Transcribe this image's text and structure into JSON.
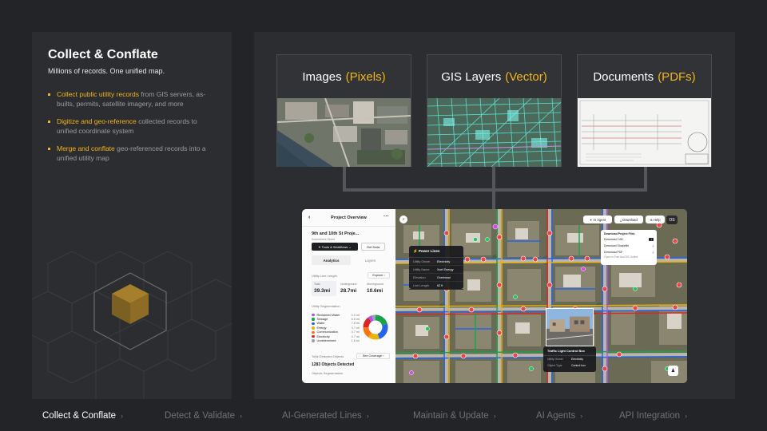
{
  "left": {
    "title": "Collect & Conflate",
    "subtitle": "Millions of records. One unified map.",
    "bullets": [
      {
        "highlight": "Collect public utility records",
        "rest": " from GIS servers, as-builts, permits, satellite imagery, and more"
      },
      {
        "highlight": "Digitize and geo-reference",
        "rest": " collected records to unified coordinate system"
      },
      {
        "highlight": "Merge and conflate",
        "rest": " geo-referenced records into a unified utility map"
      }
    ]
  },
  "cards": [
    {
      "title": "Images",
      "accent": "(Pixels)"
    },
    {
      "title": "GIS Layers",
      "accent": "(Vector)"
    },
    {
      "title": "Documents",
      "accent": "(PDFs)"
    }
  ],
  "app": {
    "panel_title": "Project Overview",
    "project_name": "9th and 10th St Proje...",
    "project_sub": "Somewhere Street",
    "tools_label": "✦ Tools & Workflows ⌄",
    "get_data": "Get Data",
    "tabs": [
      "Analytics",
      "Layers"
    ],
    "utility_line_length_label": "Utility Line Length",
    "explore": "Explore ›",
    "stats": [
      {
        "label": "Total",
        "value": "39.3mi"
      },
      {
        "label": "Underground",
        "value": "28.7mi"
      },
      {
        "label": "Aboveground",
        "value": "10.6mi"
      }
    ],
    "segmentation_label": "Utility Segmentation",
    "segments": [
      {
        "name": "Reclaimed Water",
        "value": "0.2 mi",
        "color": "#a855f7"
      },
      {
        "name": "Sewage",
        "value": "6.5 mi",
        "color": "#16a34a"
      },
      {
        "name": "Water",
        "value": "7.6 mi",
        "color": "#2563eb"
      },
      {
        "name": "Energy",
        "value": "4.7 mi",
        "color": "#eab308"
      },
      {
        "name": "Communication",
        "value": "4.7 mi",
        "color": "#f97316"
      },
      {
        "name": "Electricity",
        "value": "4.7 mi",
        "color": "#dc2626"
      },
      {
        "name": "Undetermined",
        "value": "1.6 mi",
        "color": "#9ca3af"
      }
    ],
    "detected_label": "Total Detected Objects",
    "see_coverage": "See Coverage ›",
    "objects_detected": "1283 Objects Detected",
    "objects_seg_label": "Objects Segmentation",
    "ai_agent": "✦ AI Agent",
    "download": "⤓ Download",
    "help": "⊕ Help",
    "avatar": "OS",
    "popup": {
      "title": "⚡ Power Lines",
      "rows": [
        [
          "Utility Owner",
          "Electricity"
        ],
        [
          "Utility Name",
          "Xcel Energy"
        ],
        [
          "Elevation",
          "Overhead"
        ],
        [
          "Line Length",
          "62 ft"
        ]
      ]
    },
    "download_panel": {
      "title": "Download Project Files",
      "rows": [
        "Download CAD",
        "Download Shapefile",
        "Download PDF"
      ],
      "footer": "Open in Esri ArcGIS Online"
    },
    "traffic_panel": {
      "title": "Traffic Light Control Box",
      "rows": [
        [
          "Utility Owner",
          "Electricity"
        ],
        [
          "Object Type",
          "Control box"
        ]
      ]
    }
  },
  "nav": [
    {
      "label": "Collect & Conflate",
      "active": true
    },
    {
      "label": "Detect & Validate",
      "active": false
    },
    {
      "label": "AI-Generated Lines",
      "active": false
    },
    {
      "label": "Maintain & Update",
      "active": false
    },
    {
      "label": "AI Agents",
      "active": false
    },
    {
      "label": "API Integration",
      "active": false
    }
  ],
  "colors": {
    "accent": "#f2b51c",
    "background": "#232427",
    "panel": "#2c2d30"
  }
}
